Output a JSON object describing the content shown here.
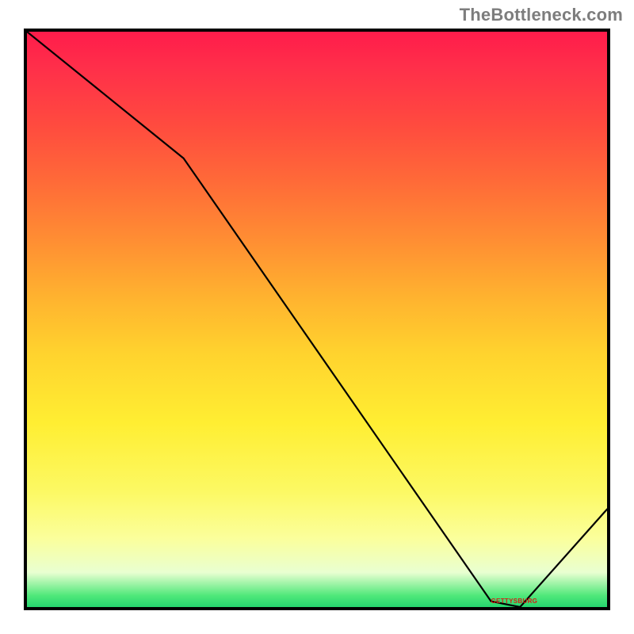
{
  "meta": {
    "watermark": "TheBottleneck.com",
    "annotation": "GETTYSBURG"
  },
  "chart_data": {
    "type": "line",
    "title": "",
    "xlabel": "",
    "ylabel": "",
    "xlim": [
      0,
      100
    ],
    "ylim": [
      0,
      100
    ],
    "grid": false,
    "legend": false,
    "x": [
      0,
      27,
      80,
      85,
      100
    ],
    "values": [
      100,
      78,
      1,
      0,
      17
    ],
    "annotations": [
      {
        "text": "GETTYSBURG",
        "x": 84,
        "y": 1
      }
    ],
    "background": "red-yellow-green vertical gradient"
  }
}
